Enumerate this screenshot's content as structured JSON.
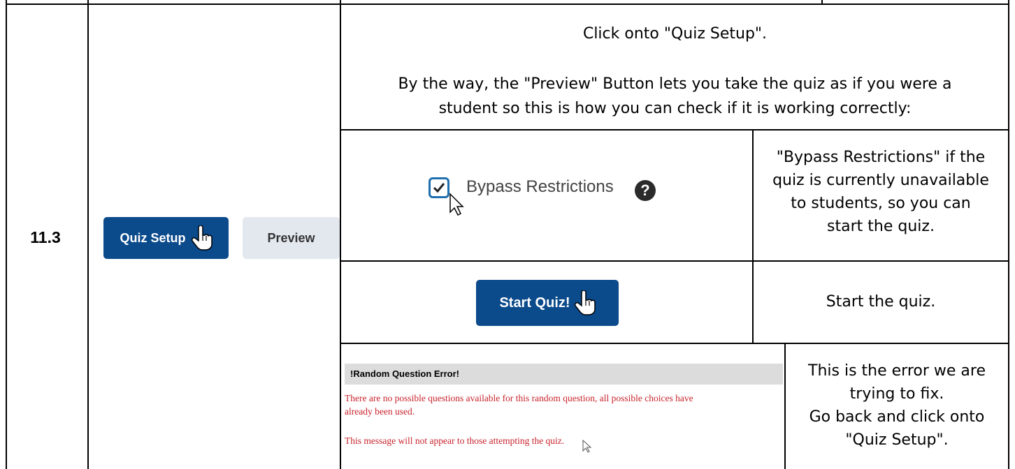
{
  "step_number": "11.3",
  "buttons": {
    "quiz_setup": "Quiz Setup",
    "preview": "Preview",
    "start_quiz": "Start Quiz!"
  },
  "instructions": {
    "intro_line1": "Click onto \"Quiz Setup\".",
    "intro_line2": "By the way, the \"Preview\" Button lets you take the quiz as if you were a",
    "intro_line3": "student so this is how you can check if it is working correctly:",
    "bypass_desc": [
      "\"Bypass Restrictions\" if the",
      "quiz is currently unavailable",
      "to students, so you can",
      "start the quiz."
    ],
    "start_desc": "Start the quiz.",
    "error_desc": [
      "This is the error we are",
      "trying to fix.",
      "Go back and click onto",
      "\"Quiz Setup\"."
    ]
  },
  "bypass": {
    "label": "Bypass Restrictions",
    "checked": true,
    "help_glyph": "?"
  },
  "error_panel": {
    "title": "!Random Question Error!",
    "message_line1": "There are no possible questions available for this random question, all possible choices have",
    "message_line2": "already been used.",
    "footnote": "This message will not appear to those attempting the quiz."
  },
  "colors": {
    "primary": "#0b4a8b",
    "secondary": "#e3e8ef",
    "error": "#c8232c",
    "check": "#1f6fae"
  },
  "icons": [
    "hand-pointer-icon",
    "arrow-cursor-icon",
    "checkmark-icon",
    "help-icon"
  ]
}
